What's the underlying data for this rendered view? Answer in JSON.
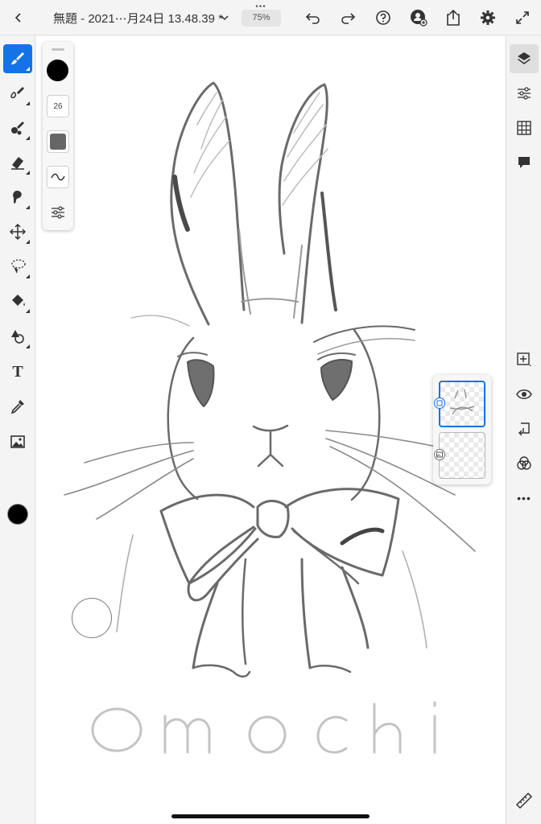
{
  "header": {
    "back_icon": "chevron-left-icon",
    "title": "無題 - 2021⋯月24日 13.48.39 *",
    "zoom": "75%",
    "more_dots": "•••"
  },
  "toolbar_left": {
    "tools": [
      "paint-brush-icon",
      "pixel-brush-icon",
      "mixer-brush-icon",
      "eraser-icon",
      "smudge-icon",
      "move-icon",
      "lasso-icon",
      "fill-icon",
      "shapes-icon",
      "text-icon",
      "eyedropper-icon",
      "image-icon"
    ],
    "active_tool": "paint-brush-icon",
    "text_tool_label": "T",
    "color": "#000000"
  },
  "brush_panel": {
    "color": "#000000",
    "size": "26"
  },
  "toolbar_right": {
    "tools": [
      "layers-icon",
      "layer-properties-icon",
      "grid-icon",
      "comments-icon",
      "add-layer-icon",
      "visibility-icon",
      "merge-down-icon",
      "blend-icon",
      "more-icon",
      "ruler-icon"
    ],
    "more_label": "•••"
  },
  "colors": {
    "accent": "#1473e6",
    "sketch": "#555555"
  },
  "canvas": {
    "lettering": "Omochi"
  }
}
